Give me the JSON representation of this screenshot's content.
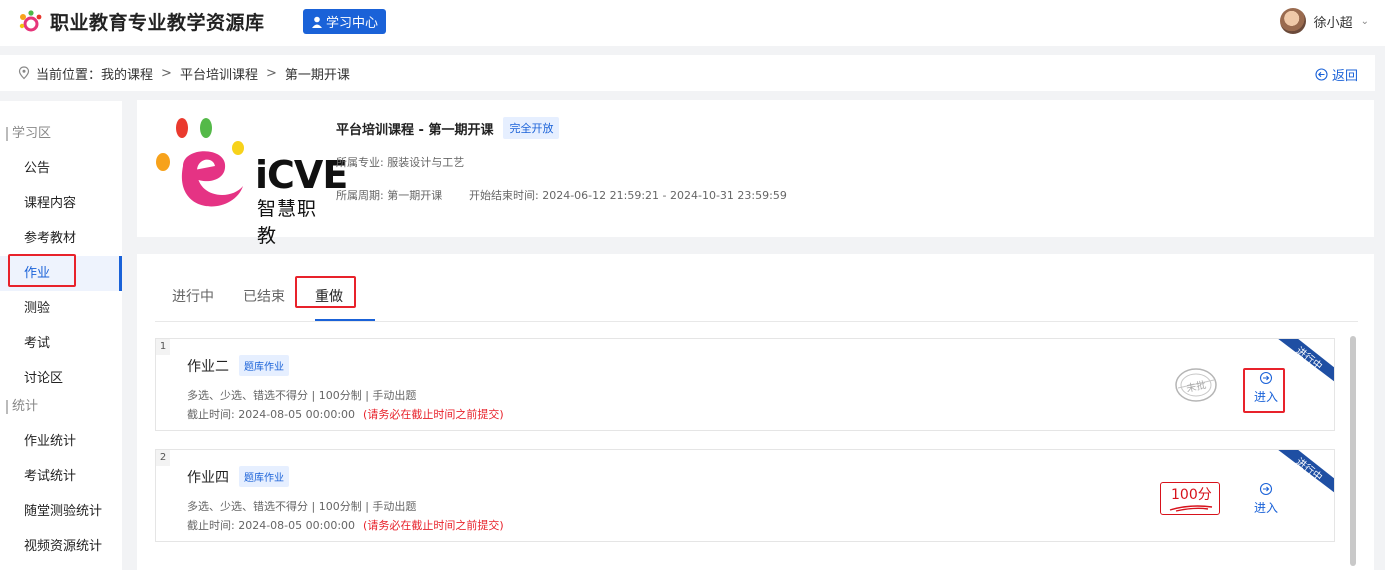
{
  "header": {
    "site_title": "职业教育专业教学资源库",
    "study_center": "学习中心",
    "user_name": "徐小超"
  },
  "breadcrumb": {
    "prefix": "当前位置：",
    "items": [
      "我的课程",
      "平台培训课程",
      "第一期开课"
    ],
    "separator": ">",
    "back": "返回"
  },
  "sidebar": {
    "group_study": "学习区",
    "study_items": [
      "公告",
      "课程内容",
      "参考教材",
      "作业",
      "测验",
      "考试",
      "讨论区"
    ],
    "group_stats": "统计",
    "stats_items": [
      "作业统计",
      "考试统计",
      "随堂测验统计",
      "视频资源统计"
    ]
  },
  "course": {
    "logo_text": "iCVE",
    "logo_sub": "智慧职教",
    "title": "平台培训课程 - 第一期开课",
    "badge": "完全开放",
    "major": "所属专业: 服装设计与工艺",
    "period": "所属周期: 第一期开课",
    "time": "开始结束时间: 2024-06-12 21:59:21 - 2024-10-31 23:59:59"
  },
  "tabs": [
    "进行中",
    "已结束",
    "重做"
  ],
  "assignments": [
    {
      "index": "1",
      "name": "作业二",
      "tag": "题库作业",
      "rule": "多选、少选、错选不得分  |  100分制  |  手动出题",
      "deadline": "截止时间: 2024-08-05 00:00:00",
      "warning": "(请务必在截止时间之前提交)",
      "ribbon": "进行中",
      "stamp": "未批",
      "enter": "进入"
    },
    {
      "index": "2",
      "name": "作业四",
      "tag": "题库作业",
      "rule": "多选、少选、错选不得分  |  100分制  |  手动出题",
      "deadline": "截止时间: 2024-08-05 00:00:00",
      "warning": "(请务必在截止时间之前提交)",
      "ribbon": "进行中",
      "score": "100分",
      "enter": "进入"
    }
  ],
  "colors": {
    "primary": "#1a62d8",
    "highlight": "#e8222b",
    "ribbon": "#1f4fa3"
  }
}
